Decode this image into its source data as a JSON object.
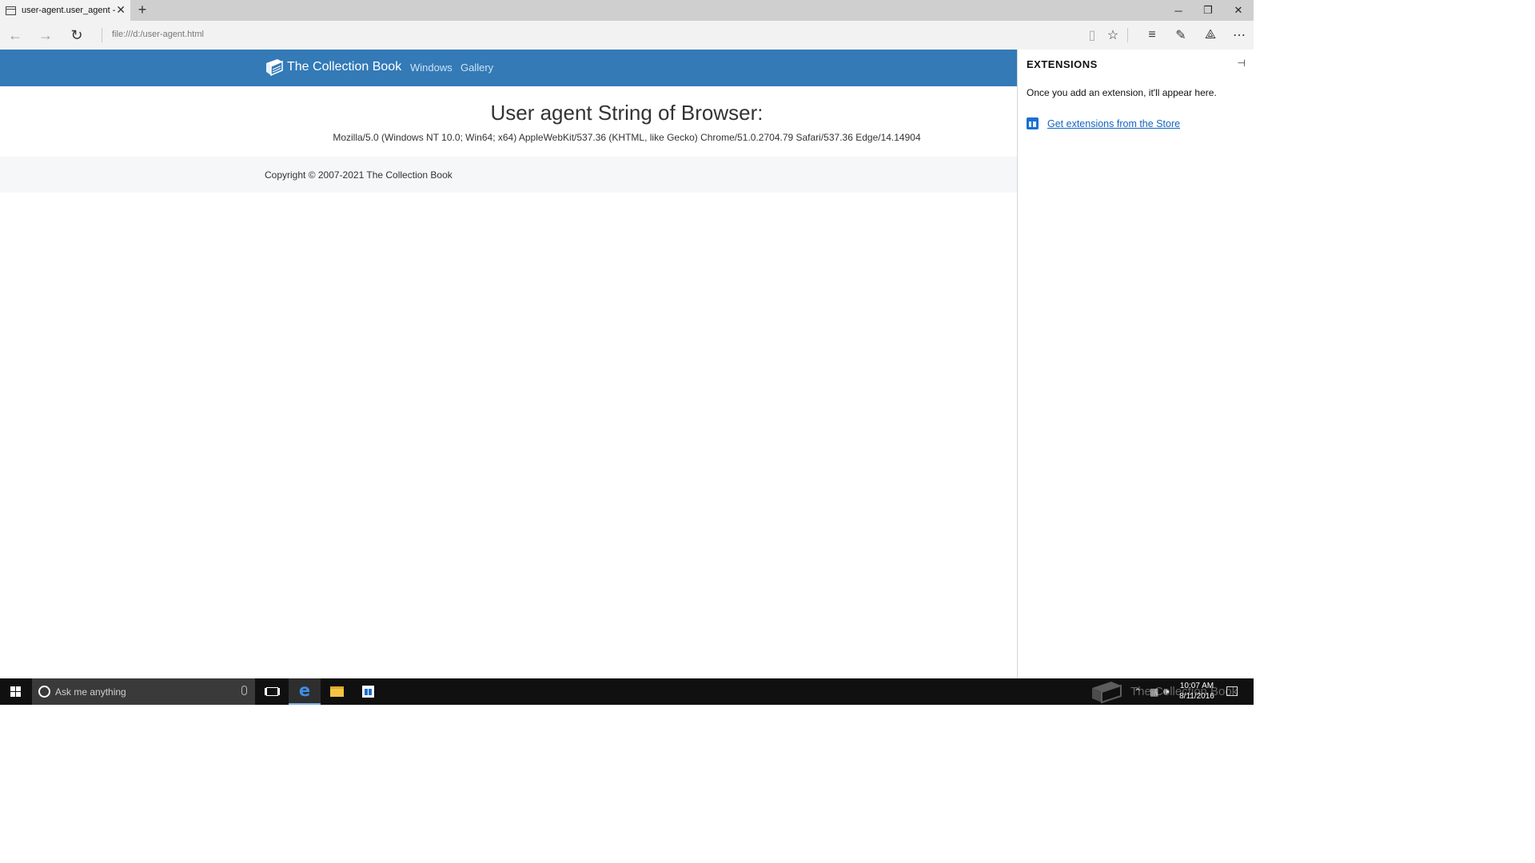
{
  "window": {
    "tab_title": "user-agent.user_agent -",
    "url": "file:///d:/user-agent.html"
  },
  "site": {
    "brand": "The Collection Book",
    "nav": [
      "Windows",
      "Gallery"
    ],
    "heading": "User agent String of Browser:",
    "user_agent": "Mozilla/5.0 (Windows NT 10.0; Win64; x64) AppleWebKit/537.36 (KHTML, like Gecko) Chrome/51.0.2704.79 Safari/537.36 Edge/14.14904",
    "copyright": "Copyright © 2007-2021 The Collection Book",
    "colors": {
      "navbar": "#337ab7",
      "footer": "#f6f7f8"
    }
  },
  "extensions": {
    "title": "EXTENSIONS",
    "message": "Once you add an extension, it'll appear here.",
    "store_link": "Get extensions from the Store"
  },
  "taskbar": {
    "search_placeholder": "Ask me anything",
    "time": "10:07 AM",
    "date": "8/11/2016",
    "watermark": "The Collection Book",
    "apps": [
      "task-view-icon",
      "edge-icon",
      "file-explorer-icon",
      "store-icon"
    ]
  }
}
